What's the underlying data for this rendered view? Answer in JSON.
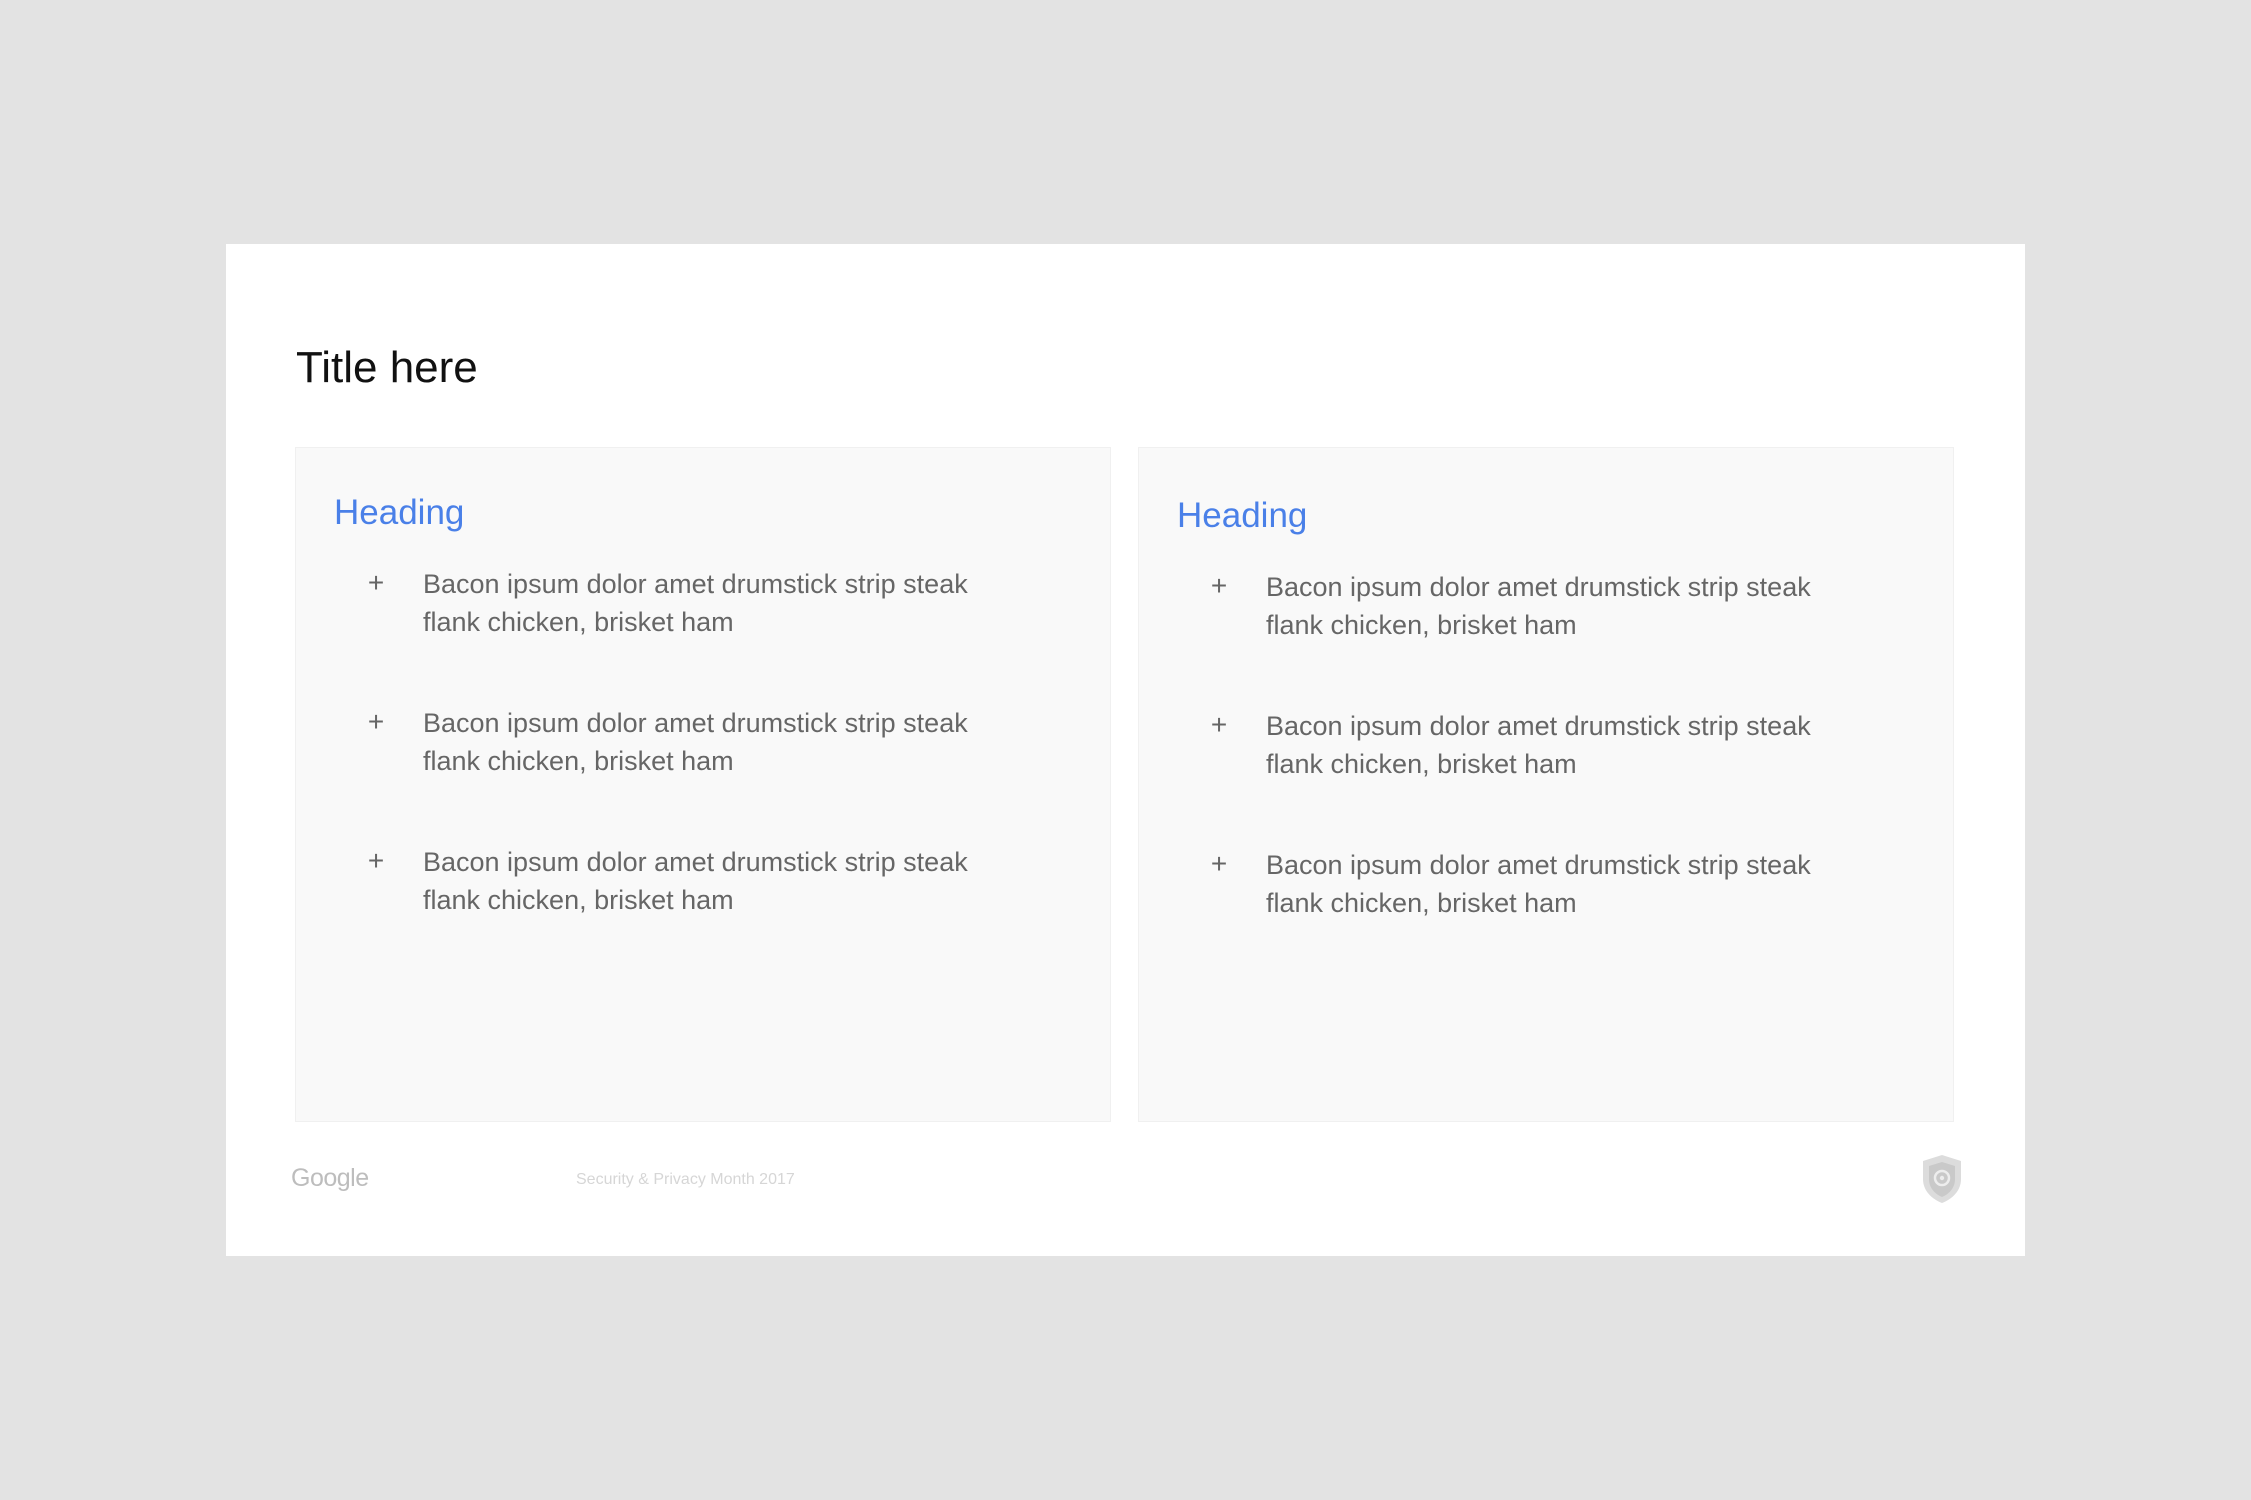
{
  "slide": {
    "title": "Title here"
  },
  "columns": [
    {
      "heading": "Heading",
      "items": [
        "Bacon ipsum dolor amet drumstick strip steak flank chicken, brisket ham",
        "Bacon ipsum dolor amet drumstick strip steak flank chicken, brisket ham",
        "Bacon ipsum dolor amet drumstick strip steak flank chicken, brisket ham"
      ]
    },
    {
      "heading": "Heading",
      "items": [
        "Bacon ipsum dolor amet drumstick strip steak flank chicken, brisket ham",
        "Bacon ipsum dolor amet drumstick strip steak flank chicken, brisket ham",
        "Bacon ipsum dolor amet drumstick strip steak flank chicken, brisket ham"
      ]
    }
  ],
  "bullet_symbol": "+",
  "footer": {
    "logo": "Google",
    "caption": "Security & Privacy Month 2017",
    "icon": "shield-icon"
  },
  "colors": {
    "background": "#e3e3e3",
    "slide": "#ffffff",
    "card": "#f9f9f9",
    "heading": "#4a80e8",
    "body_text": "#666666"
  }
}
